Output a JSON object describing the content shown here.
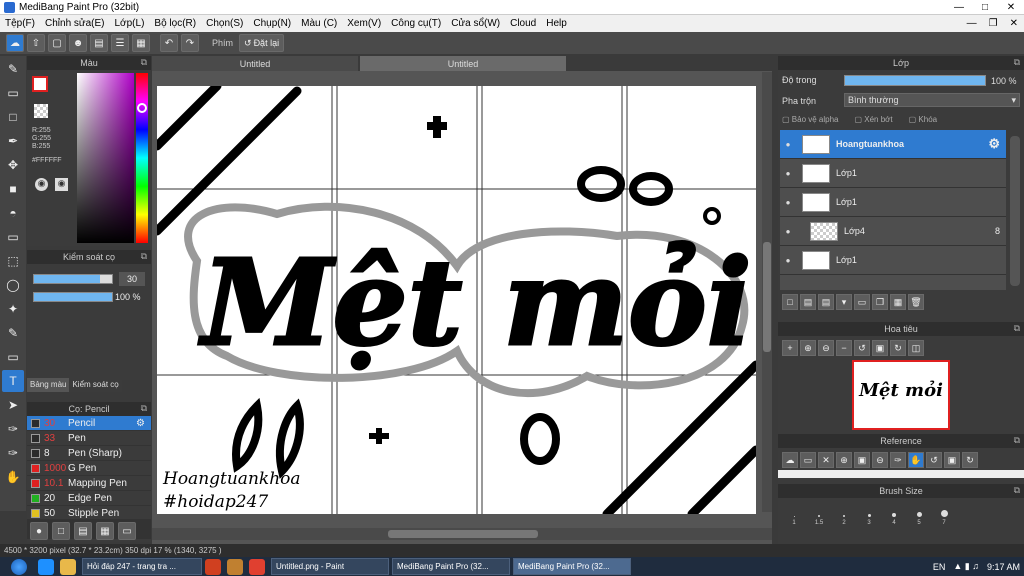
{
  "window": {
    "title": "MediBang Paint Pro (32bit)"
  },
  "menu": [
    "Tệp(F)",
    "Chỉnh sửa(E)",
    "Lớp(L)",
    "Bộ lọc(R)",
    "Chọn(S)",
    "Chụp(N)",
    "Màu (C)",
    "Xem(V)",
    "Công cụ(T)",
    "Cửa sổ(W)",
    "Cloud",
    "Help"
  ],
  "toolbar": {
    "phim_label": "Phím",
    "reset_label": "Đặt lại"
  },
  "color_panel": {
    "title": "Màu",
    "rgb": [
      "R:255",
      "G:255",
      "B:255"
    ],
    "hex": "#FFFFFF",
    "fg": "#ffffff",
    "accent": "#e02020"
  },
  "brush_control": {
    "title": "Kiểm soát cọ",
    "size": "30",
    "opacity": "100 %",
    "size_frac": 0.85,
    "opacity_frac": 1.0
  },
  "panel_tabs": [
    "Bảng màu",
    "Kiểm soát cọ"
  ],
  "brush_list": {
    "title": "Cọ: Pencil",
    "items": [
      {
        "size": "30",
        "name": "Pencil",
        "color": "#2b2b2b",
        "sizecolor": "#e04040",
        "selected": true
      },
      {
        "size": "33",
        "name": "Pen",
        "color": "#2b2b2b",
        "sizecolor": "#e04040",
        "selected": false
      },
      {
        "size": "8",
        "name": "Pen (Sharp)",
        "color": "#2b2b2b",
        "sizecolor": "#eeeeee",
        "selected": false
      },
      {
        "size": "1000",
        "name": "G Pen",
        "color": "#e02020",
        "sizecolor": "#e04040",
        "selected": false
      },
      {
        "size": "10.1",
        "name": "Mapping Pen",
        "color": "#e02020",
        "sizecolor": "#e04040",
        "selected": false
      },
      {
        "size": "20",
        "name": "Edge Pen",
        "color": "#20b020",
        "sizecolor": "#eeeeee",
        "selected": false
      },
      {
        "size": "50",
        "name": "Stipple Pen",
        "color": "#e0c020",
        "sizecolor": "#eeeeee",
        "selected": false
      }
    ]
  },
  "tabs": [
    "Untitled",
    "Untitled"
  ],
  "canvas": {
    "title_text": "Mệt mỏi",
    "signature": "Hoangtuankhoa",
    "hashtag": "#hoidap247"
  },
  "layers_panel": {
    "title": "Lớp",
    "opacity_label": "Độ trong",
    "opacity_value": "100 %",
    "blend_label": "Pha trộn",
    "blend_value": "Bình thường",
    "protect_alpha": "Bảo vệ alpha",
    "clip": "Xén bớt",
    "lock": "Khóa",
    "layers": [
      {
        "name": "Hoangtuankhoa",
        "selected": true
      },
      {
        "name": "Lớp1",
        "selected": false
      },
      {
        "name": "Lớp1",
        "selected": false
      },
      {
        "name": "Lớp4",
        "selected": false,
        "badge": "8"
      },
      {
        "name": "Lớp1",
        "selected": false
      }
    ]
  },
  "navigator": {
    "title": "Hoa tiêu"
  },
  "reference": {
    "title": "Reference"
  },
  "brush_size": {
    "title": "Brush Size",
    "sizes": [
      "1",
      "1.5",
      "2",
      "3",
      "4",
      "5",
      "7"
    ]
  },
  "status": {
    "text": "4500 * 3200 pixel  (32.7 * 23.2cm)  350 dpi  17 %  (1340, 3275 )"
  },
  "taskbar": {
    "tasks": [
      "Hỏi đáp 247 - trang tra ...",
      "Untitled.png - Paint",
      "MediBang Paint Pro (32...",
      "MediBang Paint Pro (32..."
    ],
    "lang": "EN",
    "time": "9:17 AM"
  }
}
